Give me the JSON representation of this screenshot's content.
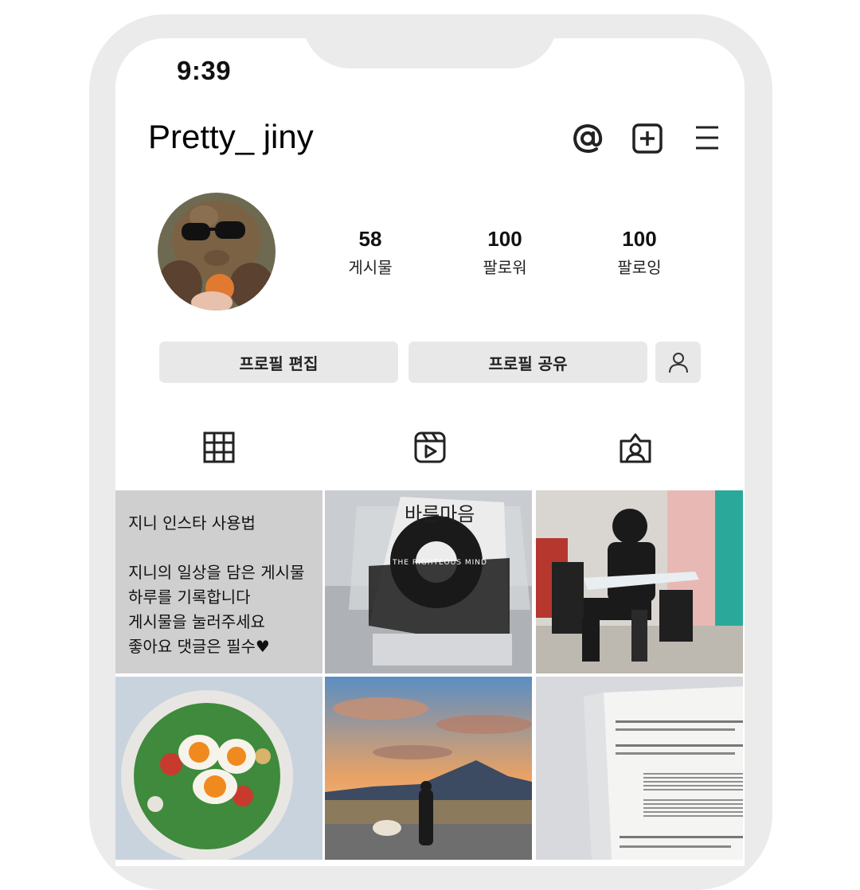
{
  "status_bar": {
    "time": "9:39"
  },
  "header": {
    "username": "Pretty_ jiny",
    "threads_icon": "at-icon",
    "create_icon": "plus-square-icon",
    "menu_icon": "hamburger-icon"
  },
  "profile": {
    "avatar_icon": "avatar-photo",
    "stats": [
      {
        "value": "58",
        "label": "게시물"
      },
      {
        "value": "100",
        "label": "팔로워"
      },
      {
        "value": "100",
        "label": "팔로잉"
      }
    ]
  },
  "actions": {
    "edit_label": "프로필 편집",
    "share_label": "프로필 공유",
    "discover_icon": "person-icon"
  },
  "tabs": [
    {
      "icon": "grid-icon"
    },
    {
      "icon": "reels-icon"
    },
    {
      "icon": "tagged-icon"
    }
  ],
  "posts": {
    "intro_lines": [
      "지니 인스타 사용법",
      "",
      "지니의 일상을 담은 게시물",
      "하루를 기록합니다",
      "게시물을 눌러주세요",
      "좋아요 댓글은 필수♥"
    ],
    "book_title": "바른마음",
    "book_subtitle": "THE RIGHTEOUS MIND"
  },
  "colors": {
    "frame": "#ebebeb",
    "button_bg": "#e8e8e8",
    "intro_bg": "#cfcfcf"
  }
}
